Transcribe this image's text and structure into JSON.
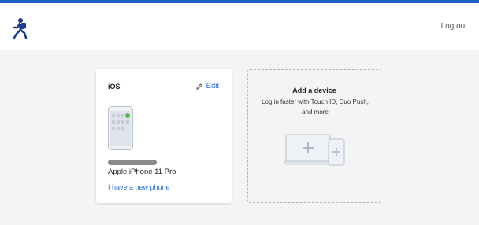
{
  "header": {
    "logo_icon": "running-person-logo",
    "logout_label": "Log out"
  },
  "colors": {
    "accent_bar": "#1f5fc6",
    "link": "#2a6fdb",
    "background": "#f4f4f4"
  },
  "device_card": {
    "platform": "iOS",
    "edit_label": "Edit",
    "edit_icon": "pencil-icon",
    "device_name": "Apple iPhone 11 Pro",
    "new_phone_label": "I have a new phone"
  },
  "add_device_card": {
    "title": "Add a device",
    "subtitle": "Log in faster with Touch ID, Duo Push, and more",
    "illustration_icon": "laptop-phone-plus-icon"
  }
}
